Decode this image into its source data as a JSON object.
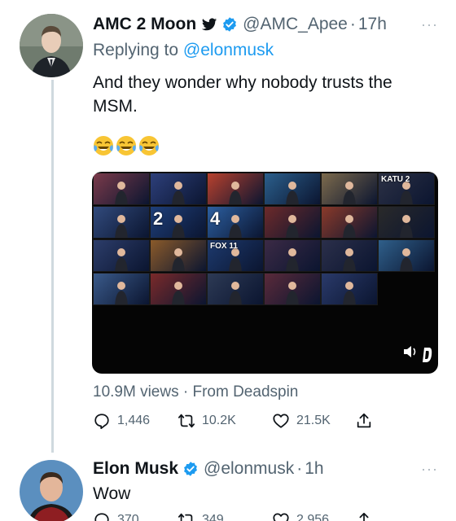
{
  "tweet1": {
    "name": "AMC 2 Moon",
    "handle": "@AMC_Apee",
    "separator": "·",
    "time": "17h",
    "more": "···",
    "replying_prefix": "Replying to",
    "replying_handle": "@elonmusk",
    "text_line1": "And they wonder why nobody trusts the",
    "text_line2": "MSM.",
    "emojis": [
      "face-with-tears-of-joy-icon",
      "face-with-tears-of-joy-icon",
      "face-with-tears-of-joy-icon"
    ],
    "views": "10.9M views · From Deadspin",
    "replies": "1,446",
    "retweets": "10.2K",
    "likes": "21.5K",
    "media": {
      "tile_colors": [
        "#7a3a4a",
        "#2d3f7a",
        "#b8412e",
        "#2b5f8c",
        "#7c6a4c",
        "#2c3145",
        "#314a7c",
        "#1e3f7a",
        "#2c5fa0",
        "#6d2a2a",
        "#8a3a2a",
        "#2a2a2a",
        "#2c3d6a",
        "#8a5a2a",
        "#1d3a6e",
        "#3b2a45",
        "#2b2f4a",
        "#2f5f8a",
        "#3a5a8a",
        "#7a2a2a",
        "#2d3a55",
        "#5a2a3a",
        "#2a3a6a"
      ],
      "overlay_text": [
        "2",
        "4",
        "FOX 11",
        "KATU 2"
      ],
      "colors": {
        "accent": "#1d9bf0",
        "muted": "#536471",
        "text": "#0f1419"
      }
    }
  },
  "tweet2": {
    "name": "Elon Musk",
    "handle": "@elonmusk",
    "separator": "·",
    "time": "1h",
    "more": "···",
    "text": "Wow",
    "replies": "370",
    "retweets": "349",
    "likes": "2,956"
  }
}
